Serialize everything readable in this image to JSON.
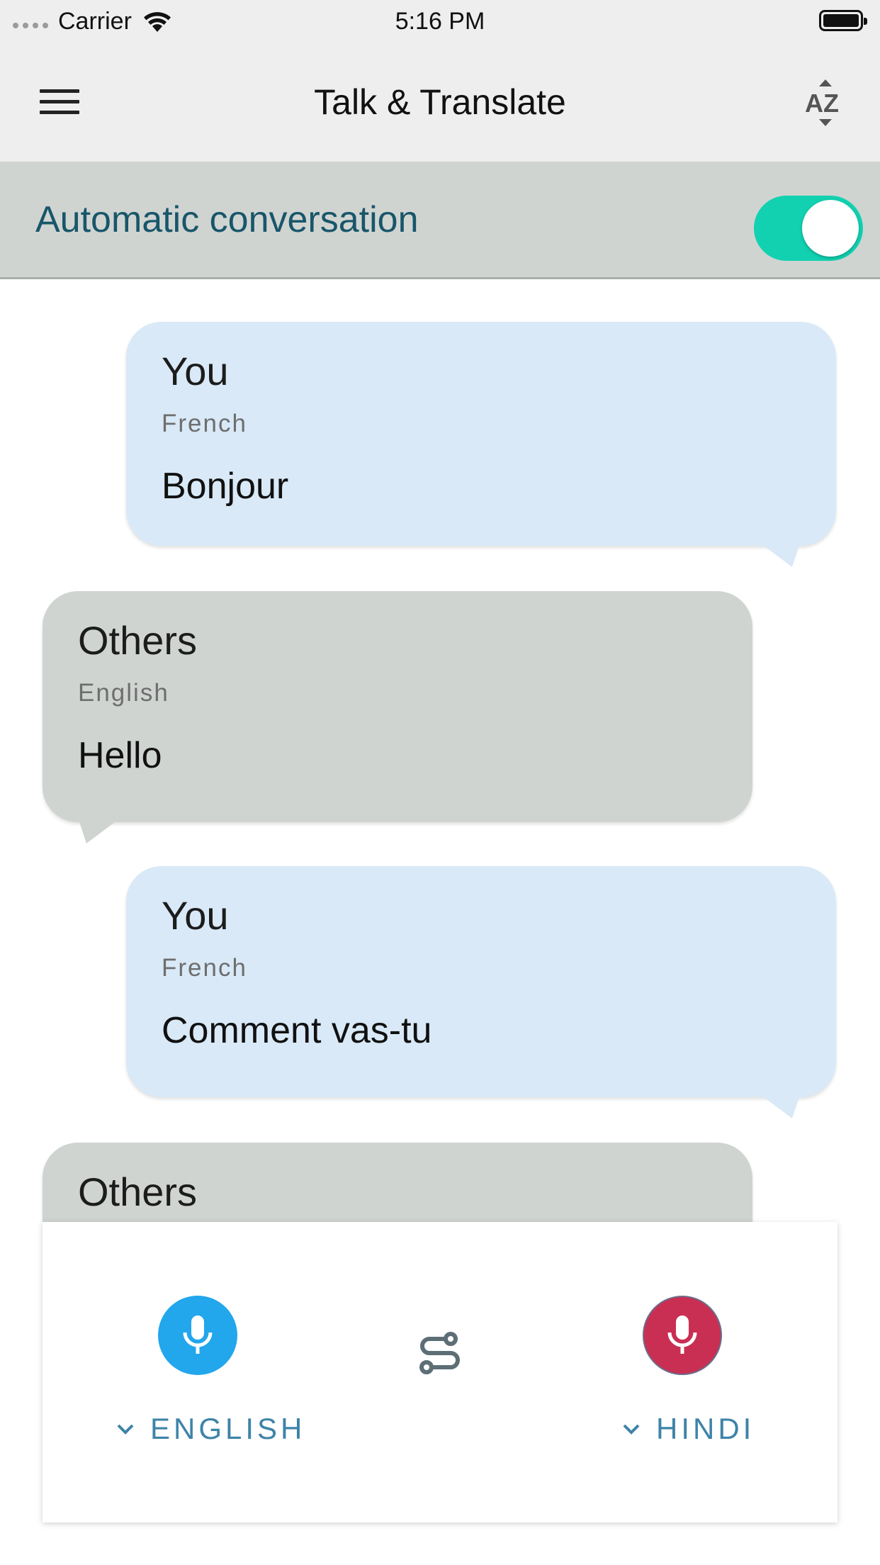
{
  "status_bar": {
    "carrier": "Carrier",
    "time": "5:16 PM"
  },
  "app_bar": {
    "title": "Talk & Translate",
    "menu_icon": "hamburger-menu-icon",
    "sort_icon": "az-sort-icon"
  },
  "auto_conversation": {
    "label": "Automatic conversation",
    "enabled": true,
    "toggle_color": "#11d1b0"
  },
  "messages": [
    {
      "speaker": "You",
      "language": "French",
      "text": "Bonjour"
    },
    {
      "speaker": "Others",
      "language": "English",
      "text": "Hello"
    },
    {
      "speaker": "You",
      "language": "French",
      "text": "Comment vas-tu"
    },
    {
      "speaker": "Others"
    }
  ],
  "controls": {
    "left_language": "ENGLISH",
    "right_language": "HINDI",
    "left_mic_color": "#22a6ec",
    "right_mic_color": "#c92f52",
    "swap_icon": "swap-languages-icon"
  }
}
